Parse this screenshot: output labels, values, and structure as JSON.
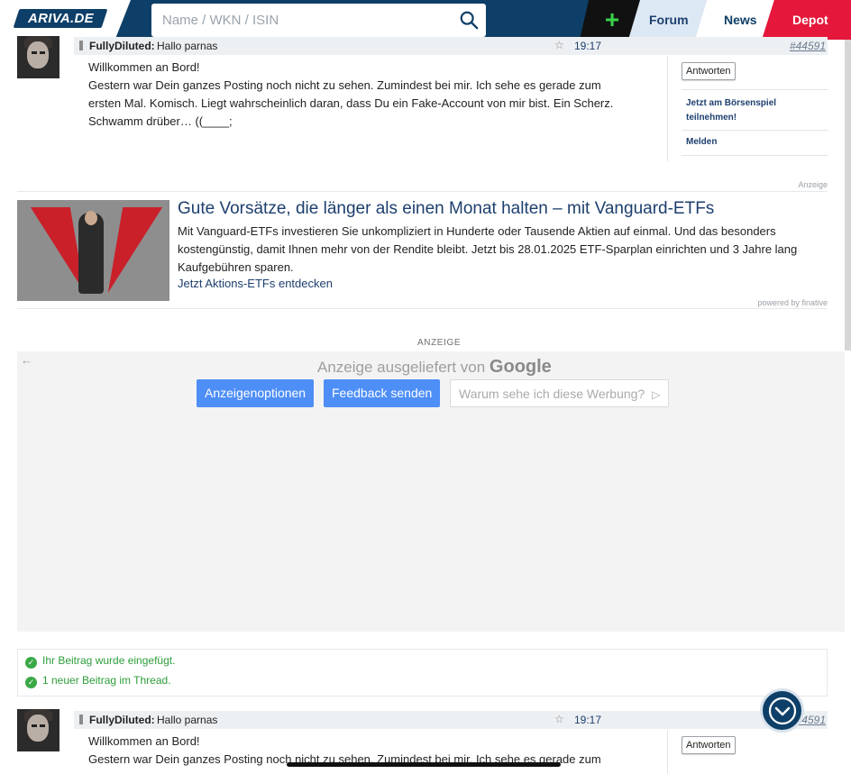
{
  "header": {
    "logo": "ARIVA.DE",
    "search_placeholder": "Name / WKN / ISIN",
    "plus": "+",
    "tabs": {
      "forum": "Forum",
      "news": "News",
      "depot": "Depot"
    }
  },
  "posts": [
    {
      "author": "FullyDiluted:",
      "subject": "Hallo parnas",
      "time": "19:17",
      "number": "#44591",
      "body": [
        "Willkommen an Bord!",
        "Gestern war Dein ganzes Posting noch nicht zu sehen. Zumindest bei mir. Ich sehe es gerade zum",
        "ersten Mal. Komisch. Liegt wahrscheinlich daran, dass Du ein Fake-Account von mir bist. Ein Scherz.",
        "Schwamm drüber… ((____;"
      ],
      "reply": "Antworten",
      "links": [
        "Jetzt am Börsenspiel teilnehmen!",
        "Melden"
      ]
    },
    {
      "author": "FullyDiluted:",
      "subject": "Hallo parnas",
      "time": "19:17",
      "number": "44591",
      "body": [
        "Willkommen an Bord!",
        "Gestern war Dein ganzes Posting noch nicht zu sehen. Zumindest bei mir. Ich sehe es gerade zum"
      ],
      "reply": "Antworten"
    }
  ],
  "ad": {
    "label": "Anzeige",
    "title": "Gute Vorsätze, die länger als einen Monat halten – mit Vanguard-ETFs",
    "text": [
      "Mit Vanguard-ETFs investieren Sie unkompliziert in Hunderte oder Tausende Aktien auf einmal. Und das besonders",
      "kostengünstig, damit Ihnen mehr von der Rendite bleibt. Jetzt bis 28.01.2025 ETF-Sparplan einrichten und 3 Jahre lang",
      "Kaufgebühren sparen."
    ],
    "link": "Jetzt Aktions-ETFs entdecken",
    "powered": "powered by finative"
  },
  "google_ad": {
    "label": "ANZEIGE",
    "delivered_by": "Anzeige ausgeliefert von",
    "brand": "Google",
    "buttons": {
      "options": "Anzeigenoptionen",
      "feedback": "Feedback senden",
      "why": "Warum sehe ich diese Werbung?"
    }
  },
  "notices": [
    "Ihr Beitrag wurde eingefügt.",
    "1 neuer Beitrag im Thread."
  ],
  "colors": {
    "navy": "#0d3f68",
    "red": "#e5173a",
    "green": "#39d14a",
    "link": "#1d3f6e",
    "google_blue": "#4e8ef7"
  }
}
